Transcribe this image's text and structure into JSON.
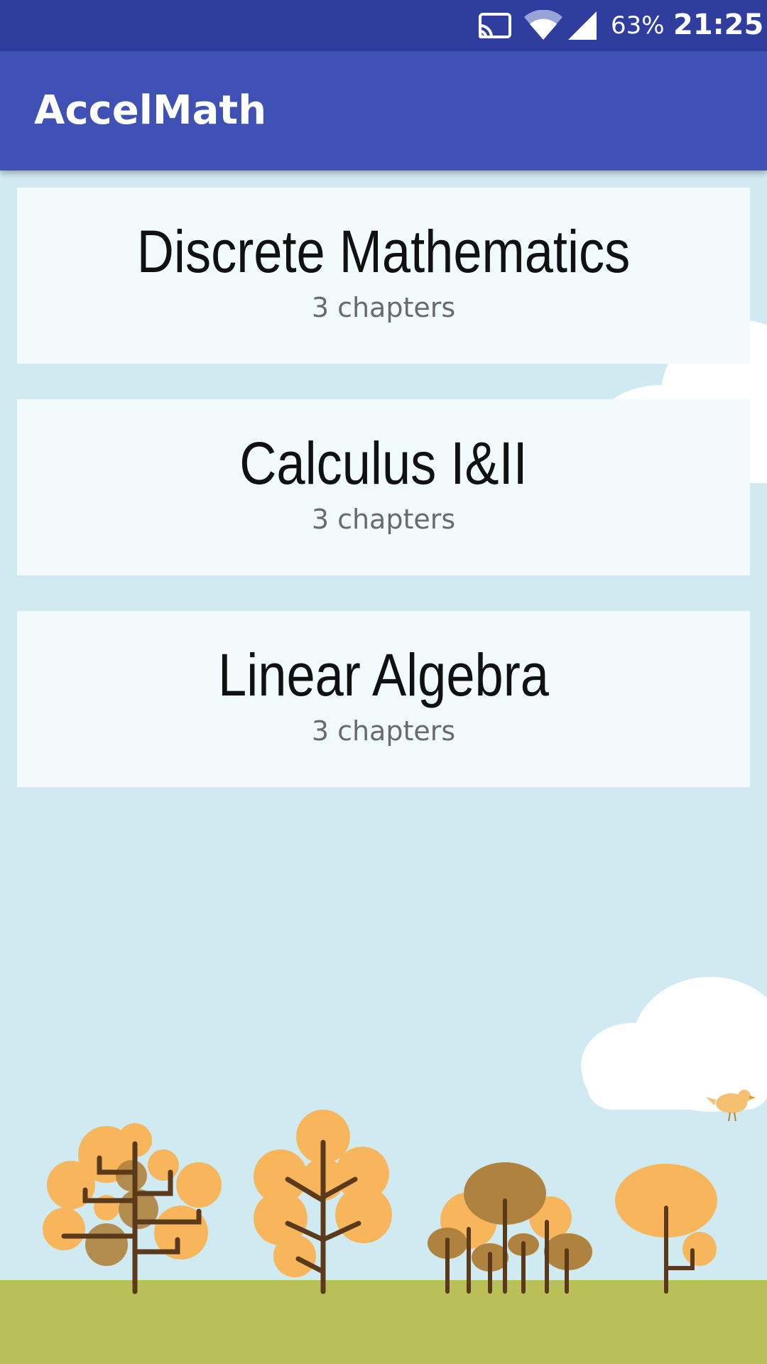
{
  "status_bar": {
    "battery": "63%",
    "time": "21:25",
    "icons": [
      "cast-icon",
      "wifi-icon",
      "cell-signal-icon"
    ]
  },
  "app_bar": {
    "title": "AccelMath"
  },
  "courses": [
    {
      "title": "Discrete Mathematics",
      "subtitle": "3 chapters"
    },
    {
      "title": "Calculus I&II",
      "subtitle": "3 chapters"
    },
    {
      "title": "Linear Algebra",
      "subtitle": "3 chapters"
    }
  ],
  "colors": {
    "status_bar": "#2f3d9e",
    "app_bar": "#3f51b5",
    "background": "#cfeaf0",
    "card": "#f2fbfc",
    "ground": "#b9c057",
    "foliage": "#f7b65b",
    "foliage_dark": "#b0823f",
    "trunk": "#5a3a1a"
  }
}
